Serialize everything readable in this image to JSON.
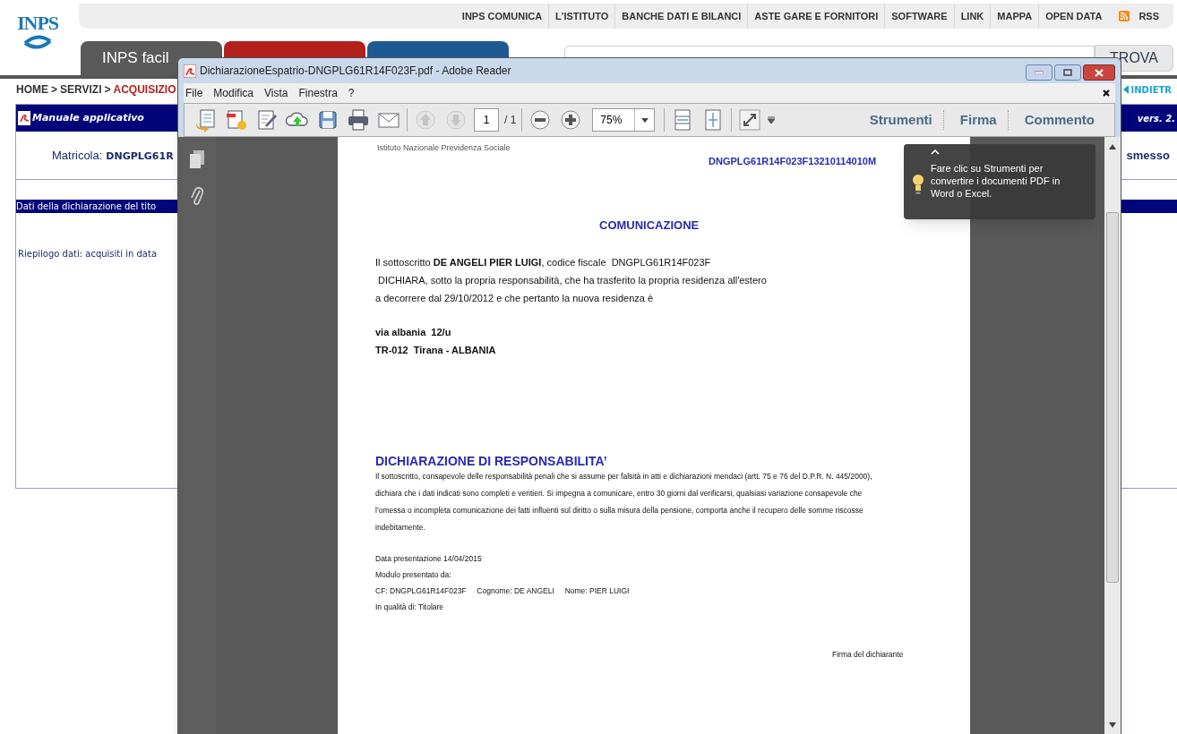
{
  "top_nav": {
    "links": [
      "INPS COMUNICA",
      "L'ISTITUTO",
      "BANCHE DATI E BILANCI",
      "ASTE GARE E FORNITORI",
      "SOFTWARE",
      "LINK",
      "MAPPA",
      "OPEN DATA"
    ],
    "rss": "RSS"
  },
  "logo": {
    "text": "INPS"
  },
  "tabs": [
    {
      "label": "INPS facil",
      "color": "#5a5a5a"
    },
    {
      "color": "#b3201c"
    },
    {
      "color": "#1d5a94"
    }
  ],
  "search": {
    "button": "TROVA"
  },
  "breadcrumb": {
    "items": [
      "HOME",
      "SERVIZI",
      "ACQUISIZIO"
    ],
    "separator": ">"
  },
  "back_link": "INDIETR",
  "panel": {
    "title": "Manuale applicativo",
    "version": "vers. 2.",
    "matricola_label": "Matricola:",
    "matricola_value": "DNGPLG61R",
    "status": "smesso",
    "section_title": "Dati della dichiarazione del tito",
    "summary": "Riepilogo dati: acquisiti in data"
  },
  "reader": {
    "title": "DichiarazioneEspatrio-DNGPLG61R14F023F.pdf - Adobe Reader",
    "menu": [
      "File",
      "Modifica",
      "Vista",
      "Finestra",
      "?"
    ],
    "page": "1",
    "page_total": "/ 1",
    "zoom": "75%",
    "panes": [
      "Strumenti",
      "Firma",
      "Commento"
    ],
    "tooltip": "Fare clic su Strumenti per convertire i documenti PDF in Word o Excel.",
    "document": {
      "organization": "Istituto Nazionale Previdenza Sociale",
      "matricola": "DNGPLG61R14F023F13210114010M",
      "heading": "COMUNICAZIONE",
      "declaration": [
        "Il sottoscritto **DE ANGELI PIER LUIGI**, codice fiscale  DNGPLG61R14F023F",
        " DICHIARA, sotto la propria responsabilità, che ha trasferito la propria residenza all'estero",
        "a decorrere dal 29/10/2012 e che pertanto la nuova residenza è"
      ],
      "address": [
        "via albania  12/u",
        "TR-012  Tirana - ALBANIA"
      ],
      "heading2": "DICHIARAZIONE DI RESPONSABILITA’",
      "responsibility": [
        "Il sottoscritto, consapevole delle responsabilità penali che si assume per falsità in atti e dichiarazioni mendaci (artt. 75 e 76 del D.P.R. N. 445/2000),",
        "dichiara che i dati indicati sono completi e veritieri. Si impegna a comunicare, entro 30 giorni dal verificarsi, qualsiasi variazione consapevole che",
        "l’omessa o incompleta comunicazione dei fatti influenti sul diritto o sulla misura della pensione, comporta anche il recupero delle somme riscosse",
        "indebitamente."
      ],
      "details": [
        "Data presentazione 14/04/2015",
        "Modulo presentato da:",
        "CF: DNGPLG61R14F023F     Cognome: DE ANGELI     Nome: PIER LUIGI",
        "In qualità di: Titolare"
      ],
      "signature": "Firma del dichiarante"
    }
  }
}
